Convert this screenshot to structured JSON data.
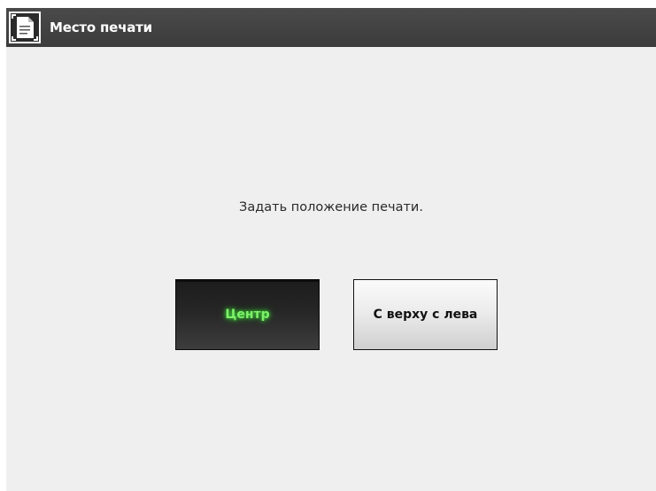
{
  "window": {
    "title": "Место печати",
    "title_icon": "document-print-position-icon"
  },
  "main": {
    "prompt": "Задать положение печати.",
    "buttons": [
      {
        "label": "Центр",
        "state": "selected"
      },
      {
        "label": "С верху с лева",
        "state": "normal"
      }
    ]
  },
  "colors": {
    "titlebar": "#404040",
    "background": "#efefef",
    "selected_text": "#7ff06a"
  }
}
